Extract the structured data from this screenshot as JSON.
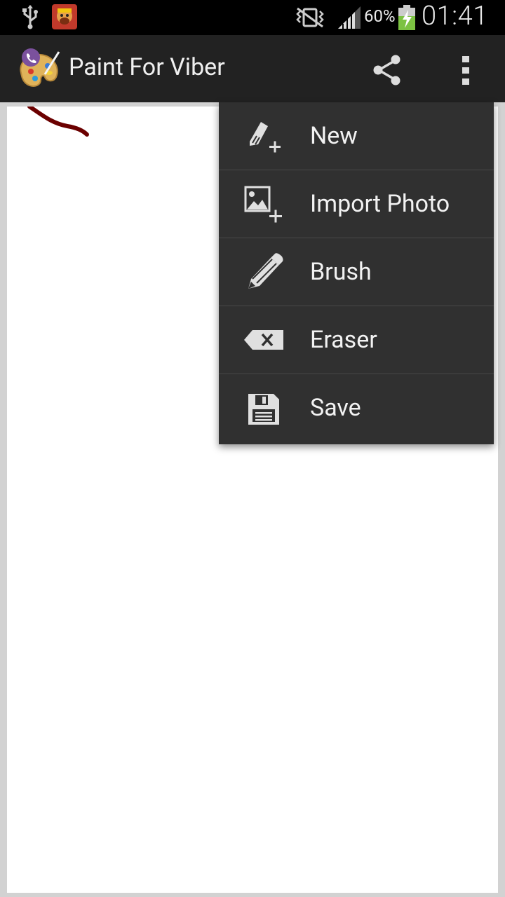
{
  "status_bar": {
    "battery_percent": "60%",
    "time": "01:41"
  },
  "action_bar": {
    "title": "Paint For Viber"
  },
  "menu": {
    "items": [
      {
        "label": "New",
        "icon": "new-drawing-icon"
      },
      {
        "label": "Import Photo",
        "icon": "import-photo-icon"
      },
      {
        "label": "Brush",
        "icon": "brush-icon"
      },
      {
        "label": "Eraser",
        "icon": "eraser-icon"
      },
      {
        "label": "Save",
        "icon": "save-icon"
      }
    ]
  },
  "colors": {
    "status_bar_bg": "#000000",
    "action_bar_bg": "#222222",
    "menu_bg": "#303030",
    "stroke_color": "#6b0000"
  }
}
